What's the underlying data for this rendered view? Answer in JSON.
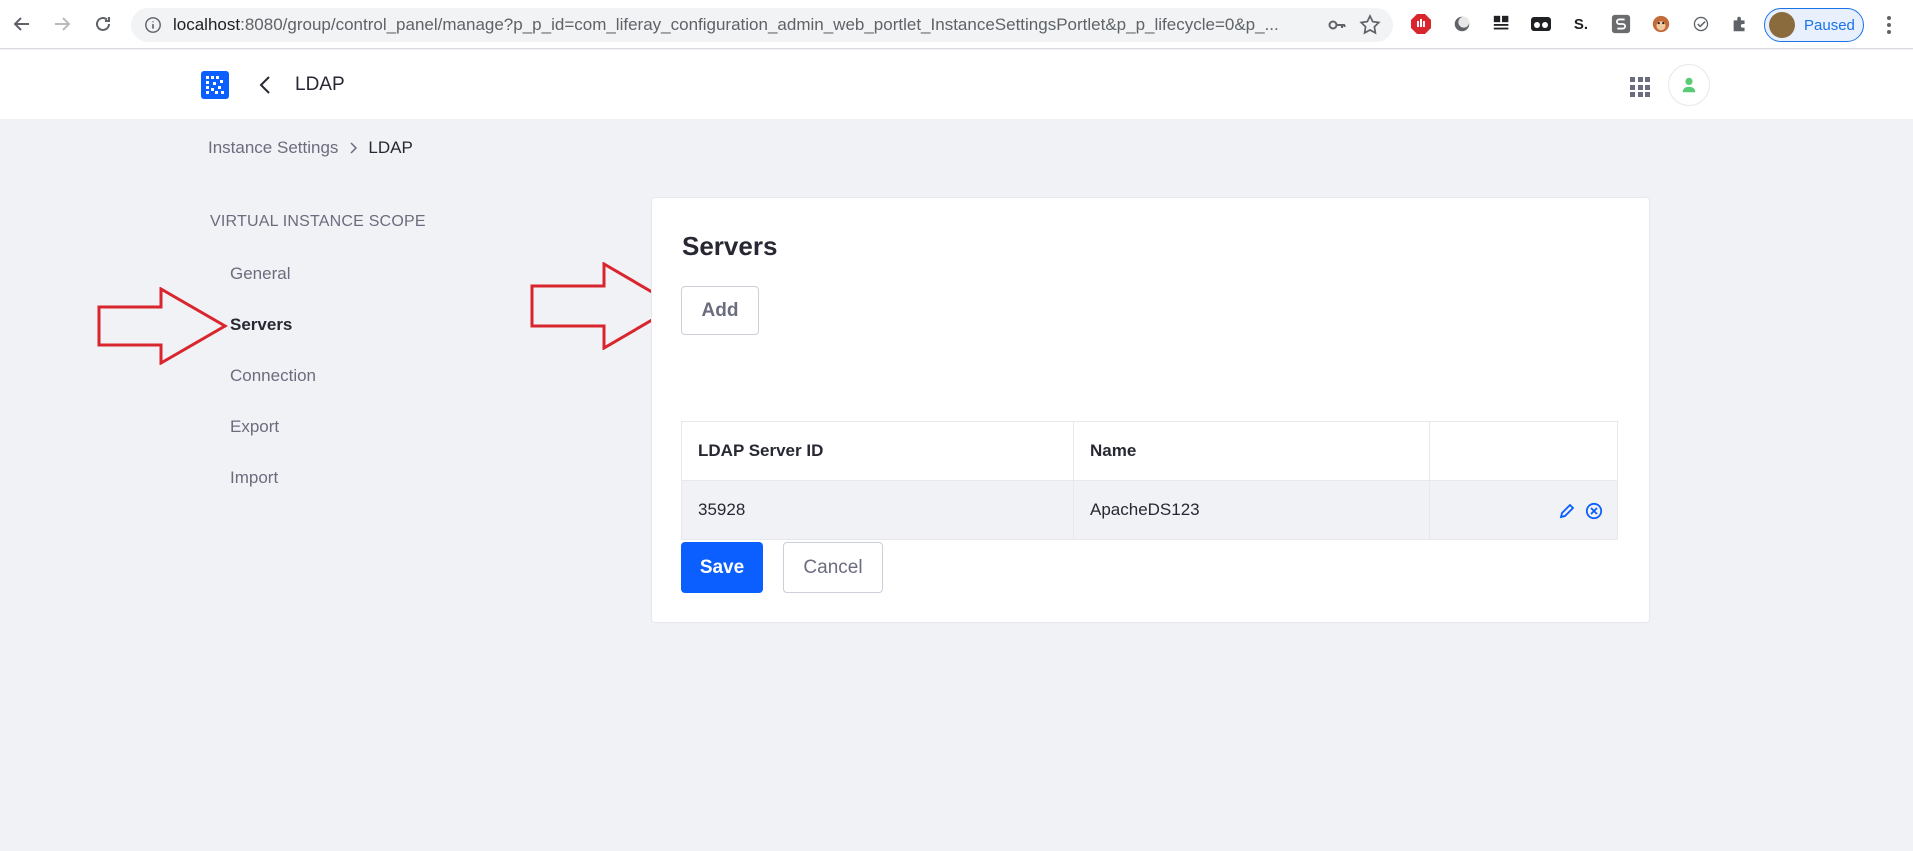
{
  "browser": {
    "url_host": "localhost",
    "url_rest": ":8080/group/control_panel/manage?p_p_id=com_liferay_configuration_admin_web_portlet_InstanceSettingsPortlet&p_p_lifecycle=0&p_...",
    "profile_status": "Paused",
    "extension_s_label": "S."
  },
  "header": {
    "title": "LDAP"
  },
  "breadcrumb": {
    "parent": "Instance Settings",
    "current": "LDAP"
  },
  "sidebar": {
    "scope_label": "VIRTUAL INSTANCE SCOPE",
    "items": [
      {
        "label": "General",
        "active": false
      },
      {
        "label": "Servers",
        "active": true
      },
      {
        "label": "Connection",
        "active": false
      },
      {
        "label": "Export",
        "active": false
      },
      {
        "label": "Import",
        "active": false
      }
    ]
  },
  "main": {
    "title": "Servers",
    "add_label": "Add",
    "table": {
      "columns": [
        "LDAP Server ID",
        "Name",
        ""
      ],
      "rows": [
        {
          "id": "35928",
          "name": "ApacheDS123"
        }
      ]
    },
    "save_label": "Save",
    "cancel_label": "Cancel"
  },
  "colors": {
    "primary": "#0b5fff",
    "annotation_arrow": "#d9262e",
    "background": "#f1f2f5"
  },
  "icons": [
    "back-arrow-icon",
    "forward-arrow-icon",
    "reload-icon",
    "info-icon",
    "key-icon",
    "star-icon",
    "apps-grid-icon",
    "user-icon",
    "pencil-icon",
    "times-circle-icon",
    "chevron-left-icon",
    "chevron-right-icon",
    "puzzle-icon"
  ]
}
